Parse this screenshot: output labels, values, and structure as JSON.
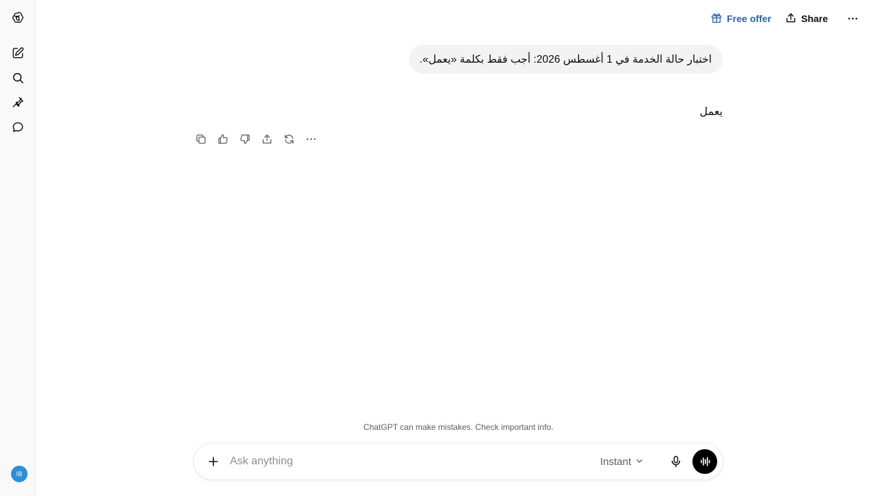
{
  "sidebar": {
    "items": [
      {
        "name": "openai-logo-icon"
      },
      {
        "name": "new-chat-icon"
      },
      {
        "name": "search-icon"
      },
      {
        "name": "pin-icon"
      },
      {
        "name": "chats-icon"
      }
    ],
    "avatar_initials": "IB"
  },
  "header": {
    "free_offer": "Free offer",
    "share": "Share"
  },
  "conversation": {
    "user_message": "اختبار حالة الخدمة في 1 أغسطس 2026: أجب فقط بكلمة «يعمل».",
    "assistant_message": "يعمل"
  },
  "footer": {
    "disclaimer": "ChatGPT can make mistakes. Check important info."
  },
  "composer": {
    "placeholder": "Ask anything",
    "model": "Instant"
  },
  "colors": {
    "accent_link": "#2964aa",
    "avatar": "#2d8fd9",
    "user_bubble": "#f3f3f3"
  }
}
